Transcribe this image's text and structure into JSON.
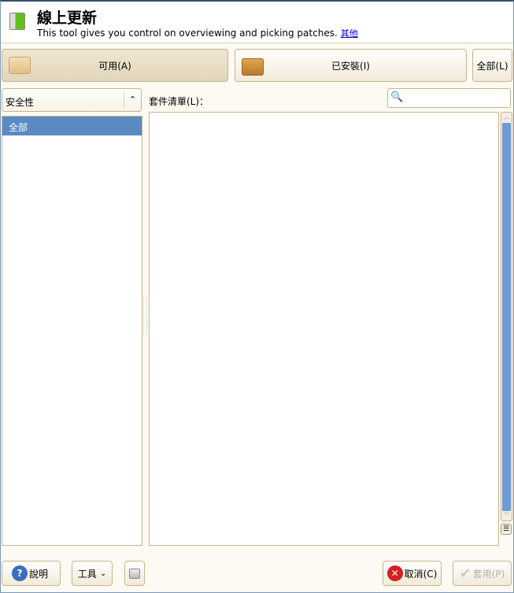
{
  "header": {
    "title": "線上更新",
    "subtitle": "This tool gives you control on overviewing and picking patches.",
    "more_link": "其他"
  },
  "filters": {
    "available": "可用(A)",
    "installed": "已安裝(I)",
    "all": "全部(L)"
  },
  "category_select": {
    "value": "安全性"
  },
  "category_list": {
    "items": [
      "全部"
    ]
  },
  "package_list": {
    "label": "套件清單(L)："
  },
  "search": {
    "value": ""
  },
  "bottom": {
    "help": "說明",
    "tools": "工具",
    "cancel": "取消(C)",
    "apply": "套用(P)"
  }
}
